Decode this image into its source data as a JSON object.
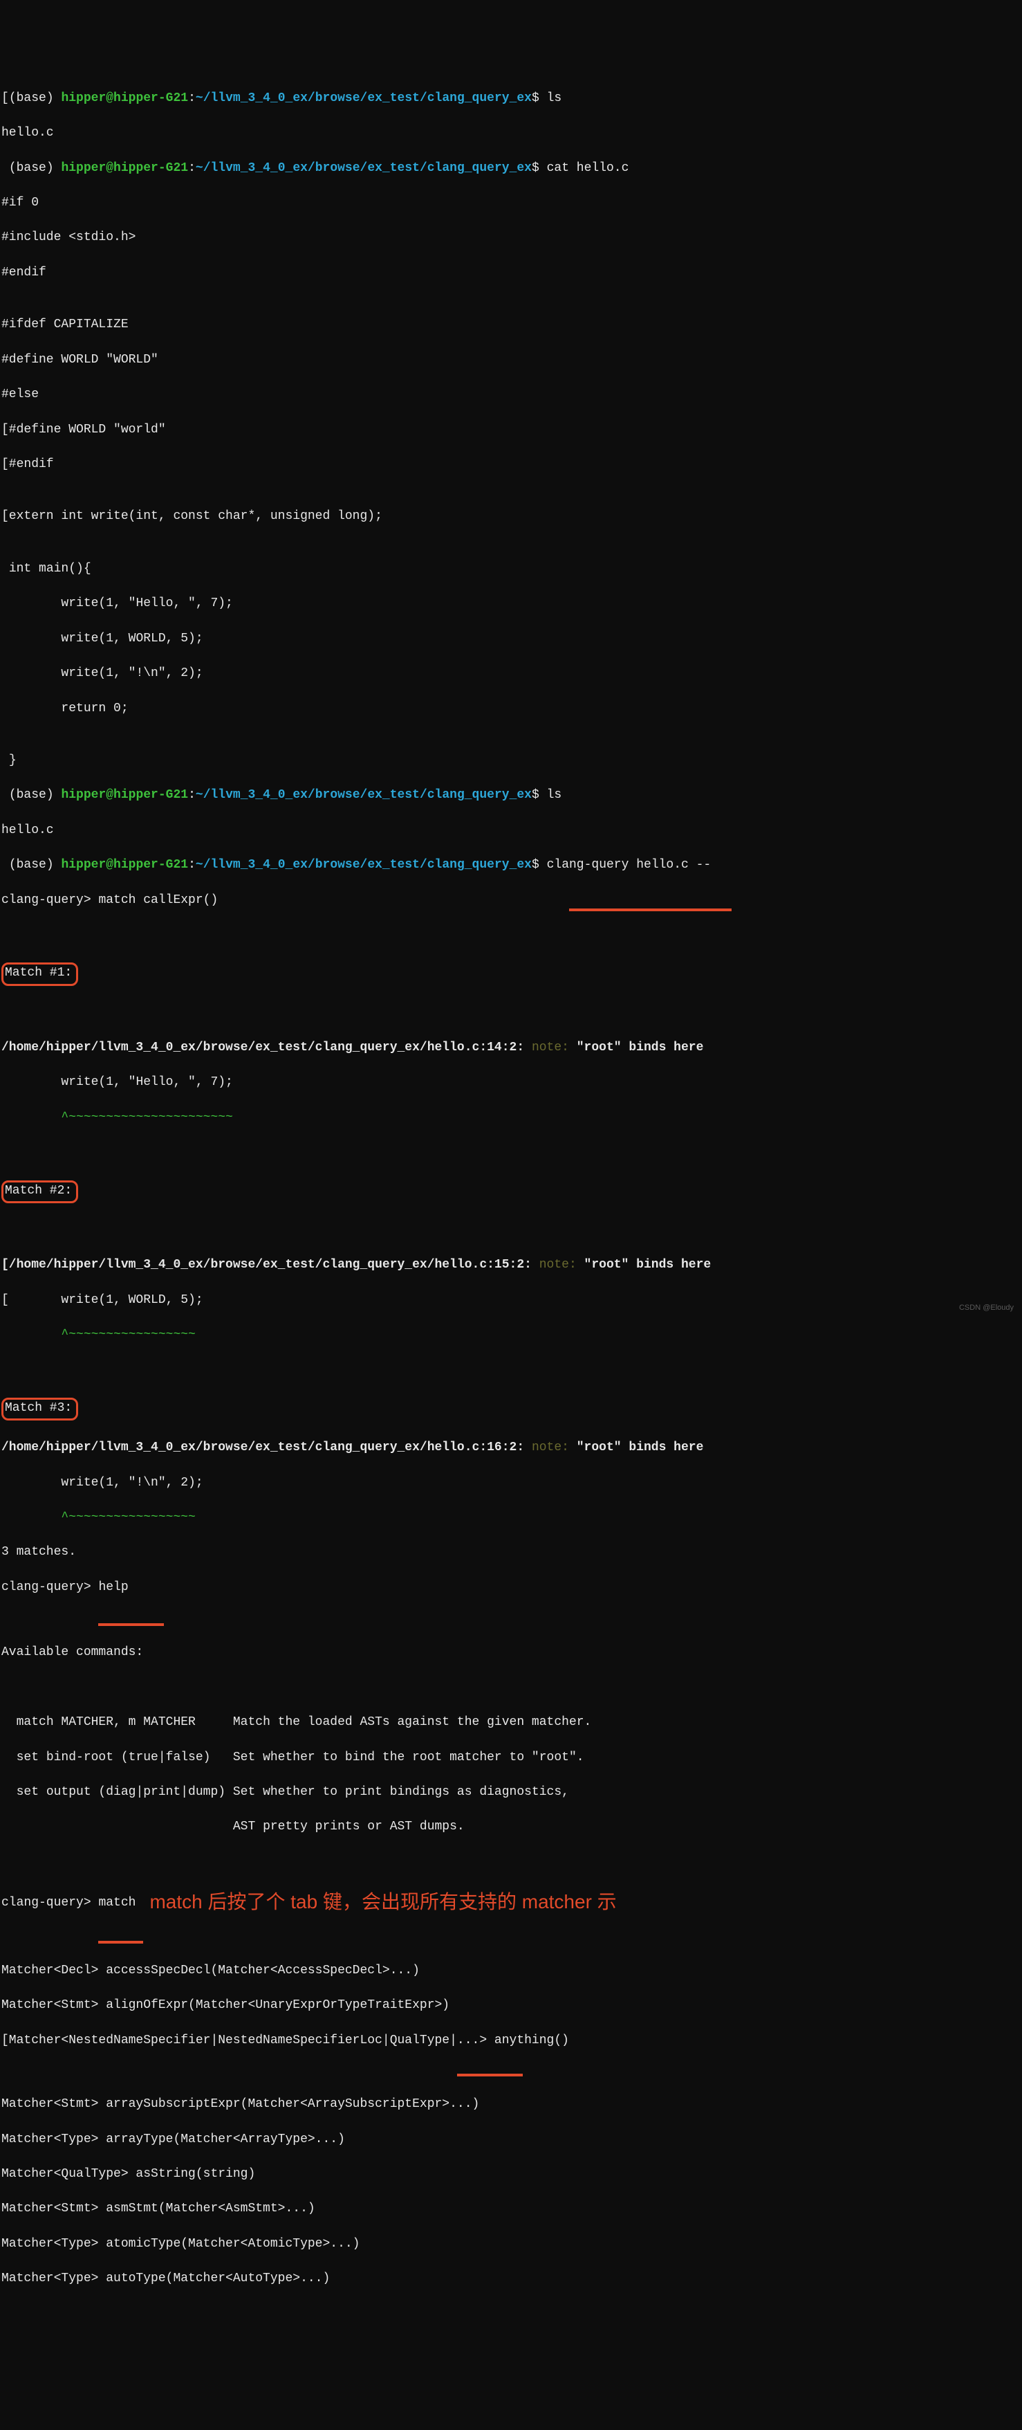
{
  "prompt": {
    "env": "(base) ",
    "user": "hipper@hipper-G21",
    "sep": ":",
    "path": "~/llvm_3_4_0_ex/browse/ex_test/clang_query_ex",
    "dollar": "$ "
  },
  "cmds": {
    "ls": "ls",
    "cat": "cat hello.c",
    "clang_query": "clang-query hello.c --",
    "match_callexpr": "match callExpr()",
    "help": "help",
    "match_only": "match"
  },
  "ls_out": "hello.c",
  "cat_out": {
    "l1": "#if 0",
    "l2": "#include <stdio.h>",
    "l3": "#endif",
    "l4": "",
    "l5": "#ifdef CAPITALIZE",
    "l6": "#define WORLD \"WORLD\"",
    "l7": "#else",
    "l8": "[#define WORLD \"world\"",
    "l9": "[#endif",
    "l10": "",
    "l11": "[extern int write(int, const char*, unsigned long);",
    "l12": "",
    "l13": " int main(){",
    "l14": "        write(1, \"Hello, \", 7);",
    "l15": "        write(1, WORLD, 5);",
    "l16": "        write(1, \"!\\n\", 2);",
    "l17": "        return 0;",
    "l18": "",
    "l19": " }"
  },
  "cq_prompt": "clang-query> ",
  "matches": {
    "m1_hdr": "Match #1:",
    "m1_loc": "/home/hipper/llvm_3_4_0_ex/browse/ex_test/clang_query_ex/hello.c:14:2: ",
    "m1_note": "note:",
    "m1_bind": " \"root\" binds here",
    "m1_code": "        write(1, \"Hello, \", 7);",
    "m1_car": "        ^~~~~~~~~~~~~~~~~~~~~~~",
    "m2_hdr": "Match #2:",
    "m2_loc": "[/home/hipper/llvm_3_4_0_ex/browse/ex_test/clang_query_ex/hello.c:15:2: ",
    "m2_note": "note:",
    "m2_bind": " \"root\" binds here",
    "m2_code": "[       write(1, WORLD, 5);",
    "m2_car": "        ^~~~~~~~~~~~~~~~~~",
    "m3_hdr": "Match #3:",
    "m3_loc": "/home/hipper/llvm_3_4_0_ex/browse/ex_test/clang_query_ex/hello.c:16:2: ",
    "m3_note": "note:",
    "m3_bind": " \"root\" binds here",
    "m3_code": "        write(1, \"!\\n\", 2);",
    "m3_car": "        ^~~~~~~~~~~~~~~~~~",
    "count": "3 matches."
  },
  "help_out": {
    "hdr": "Available commands:",
    "l1": "  match MATCHER, m MATCHER     Match the loaded ASTs against the given matcher.",
    "l2": "  set bind-root (true|false)   Set whether to bind the root matcher to \"root\".",
    "l3": "  set output (diag|print|dump) Set whether to print bindings as diagnostics,",
    "l4": "                               AST pretty prints or AST dumps."
  },
  "anno": "match 后按了个 tab 键，会出现所有支持的 matcher 示",
  "completions": {
    "l1": "Matcher<Decl> accessSpecDecl(Matcher<AccessSpecDecl>...)",
    "l2": "Matcher<Stmt> alignOfExpr(Matcher<UnaryExprOrTypeTraitExpr>)",
    "l3": "[Matcher<NestedNameSpecifier|NestedNameSpecifierLoc|QualType|...> anything()",
    "l4": "Matcher<Stmt> arraySubscriptExpr(Matcher<ArraySubscriptExpr>...)",
    "l5": "Matcher<Type> arrayType(Matcher<ArrayType>...)",
    "l6": "Matcher<QualType> asString(string)",
    "l7": "Matcher<Stmt> asmStmt(Matcher<AsmStmt>...)",
    "l8": "Matcher<Type> atomicType(Matcher<AtomicType>...)",
    "l9": "Matcher<Type> autoType(Matcher<AutoType>...)"
  },
  "watermark": "CSDN @Eloudy"
}
